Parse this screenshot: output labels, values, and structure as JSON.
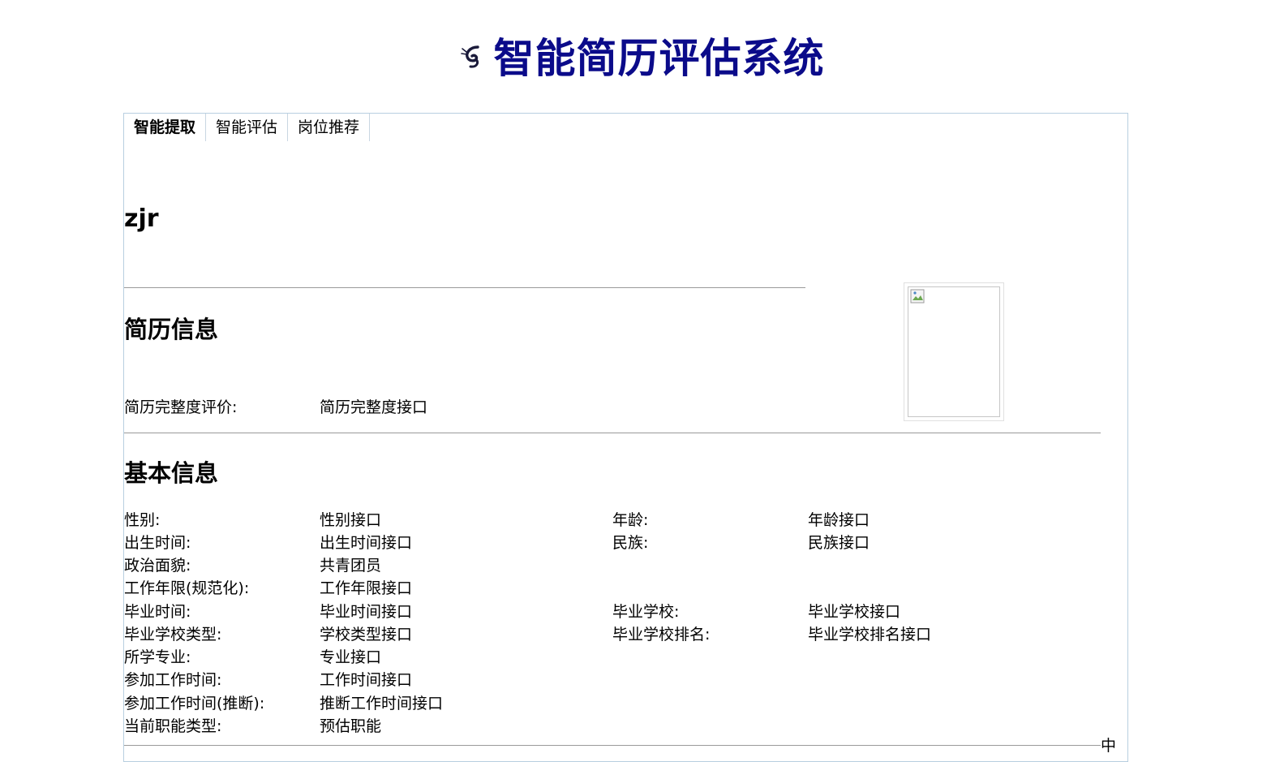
{
  "header": {
    "title": "智能简历评估系统",
    "logo_icon": "shrimp-logo-icon"
  },
  "tabs": [
    {
      "label": "智能提取",
      "active": true
    },
    {
      "label": "智能评估",
      "active": false
    },
    {
      "label": "岗位推荐",
      "active": false
    }
  ],
  "candidate": {
    "name": "zjr"
  },
  "resume_section": {
    "title": "简历信息",
    "completeness_label": "简历完整度评价:",
    "completeness_value": "简历完整度接口"
  },
  "basic_section": {
    "title": "基本信息",
    "gender_label": "性别:",
    "gender_value": "性别接口",
    "age_label": "年龄:",
    "age_value": "年龄接口",
    "birth_label": "出生时间:",
    "birth_value": "出生时间接口",
    "ethnicity_label": "民族:",
    "ethnicity_value": "民族接口",
    "political_label": "政治面貌:",
    "political_value": "共青团员",
    "work_years_label": "工作年限(规范化):",
    "work_years_value": "工作年限接口",
    "grad_time_label": "毕业时间:",
    "grad_time_value": "毕业时间接口",
    "grad_school_label": "毕业学校:",
    "grad_school_value": "毕业学校接口",
    "school_type_label": "毕业学校类型:",
    "school_type_value": "学校类型接口",
    "school_rank_label": "毕业学校排名:",
    "school_rank_value": "毕业学校排名接口",
    "major_label": "所学专业:",
    "major_value": "专业接口",
    "work_start_label": "参加工作时间:",
    "work_start_value": "工作时间接口",
    "work_start_inferred_label": "参加工作时间(推断):",
    "work_start_inferred_value": "推断工作时间接口",
    "job_type_label": "当前职能类型:",
    "job_type_value": "预估职能"
  },
  "truncated_text": "中",
  "colors": {
    "title": "#0b0b8a",
    "panel_border": "#b8cfe0"
  }
}
